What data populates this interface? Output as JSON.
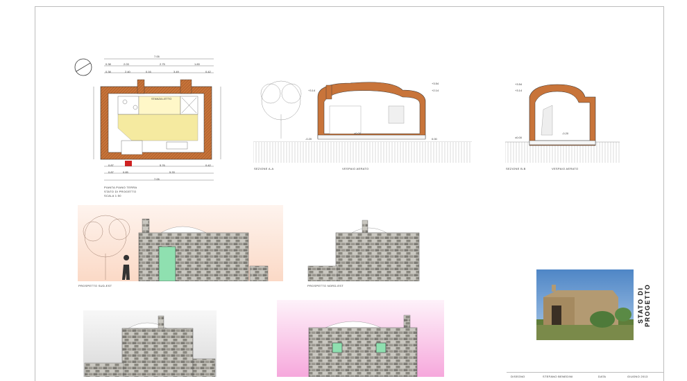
{
  "sheet": {
    "title": "STATO DI PROGETTO"
  },
  "plan": {
    "caption_line1": "PIANTA PIANO TERRA",
    "caption_line2": "STATO DI PROGETTO",
    "caption_line3": "SCALA 1:50",
    "top_dims_row1": [
      "7.05"
    ],
    "top_dims_row2": [
      "0.38",
      "2.03",
      "2.75",
      "1.83"
    ],
    "top_dims_row3": [
      "0.38",
      "2.40",
      "0.16",
      "3.49",
      "0.42"
    ],
    "bottom_dims_row1": [
      "0.87",
      "5.76",
      "0.42"
    ],
    "bottom_dims_row2": [
      "0.87",
      "0.85",
      "5.33"
    ],
    "bottom_dims_row3": [
      "7.05"
    ],
    "room_label": "STANZA LETTO"
  },
  "section_aa": {
    "caption": "SEZIONE A-A",
    "vespaio": "VESPAIO AERATO",
    "levels": [
      "+3.54",
      "+3.14",
      "+2.14",
      "±0.00",
      "-0.20",
      "0.00"
    ]
  },
  "section_bb": {
    "caption": "SEZIONE B-B",
    "vespaio": "VESPAIO AERATO",
    "levels": [
      "+3.54",
      "+3.14",
      "±0.00",
      "-0.20"
    ]
  },
  "elevations": {
    "sud_est": "PROSPETTO SUD-EST",
    "nord_est": "PROSPETTO NORD-EST"
  },
  "title_block": {
    "disegno": "DISEGNO",
    "author": "STEFANO BENEDINI",
    "data": "DATA",
    "date": "GIUGNO 2013"
  },
  "colors": {
    "wall_hatch": "#c8743a",
    "floor_fill": "#f5eaa0",
    "stone": "#8a8a86",
    "door_green": "#8fe0b0",
    "bg_peach": "#fbd9c6",
    "bg_pink": "#f6a8dc",
    "bg_grey": "#d9d9d9"
  }
}
